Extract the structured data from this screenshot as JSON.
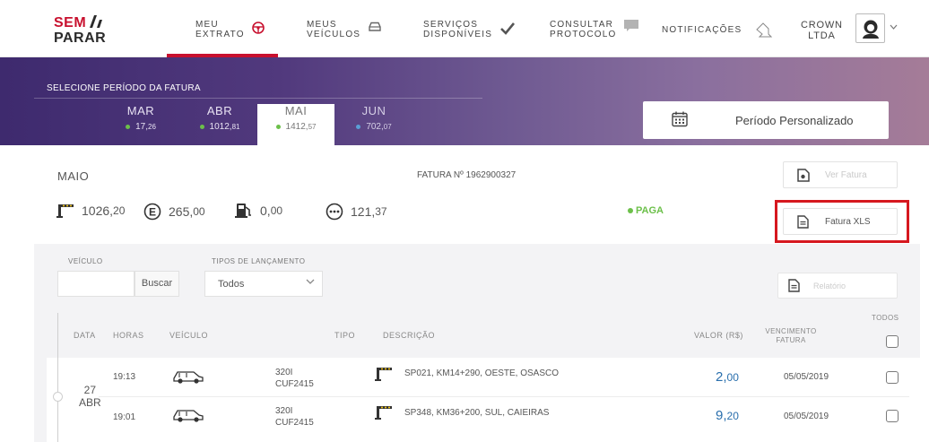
{
  "header": {
    "logo_line1": "SEM",
    "logo_line2": "PARAR",
    "nav": [
      {
        "line1": "MEU",
        "line2": "EXTRATO",
        "icon": "steering-wheel-icon",
        "active": true
      },
      {
        "line1": "MEUS",
        "line2": "VEÍCULOS",
        "icon": "car-icon",
        "active": false
      },
      {
        "line1": "SERVIÇOS",
        "line2": "DISPONÍVEIS",
        "icon": "check-icon",
        "active": false
      },
      {
        "line1": "CONSULTAR",
        "line2": "PROTOCOLO",
        "icon": "chat-bubble-icon",
        "active": false
      },
      {
        "line1": "NOTIFICAÇÕES",
        "line2": "",
        "icon": "bell-icon",
        "active": false
      }
    ],
    "company_line1": "CROWN",
    "company_line2": "LTDA",
    "accent_color": "#c8102e"
  },
  "period": {
    "title": "SELECIONE PERÍODO DA FATURA",
    "months": [
      {
        "name": "MAR",
        "value_int": "17",
        "value_dec": "26",
        "status": "paid"
      },
      {
        "name": "ABR",
        "value_int": "1012",
        "value_dec": "81",
        "status": "paid"
      },
      {
        "name": "MAI",
        "value_int": "1412",
        "value_dec": "57",
        "status": "selected"
      },
      {
        "name": "JUN",
        "value_int": "702",
        "value_dec": "07",
        "status": "open"
      }
    ],
    "custom_label": "Período Personalizado"
  },
  "summary": {
    "month": "MAIO",
    "fatura_label": "FATURA Nº 1962900327",
    "stats": [
      {
        "icon": "toll-icon",
        "int": "1026",
        "dec": "20"
      },
      {
        "icon": "parking-e-icon",
        "int": "265",
        "dec": "00"
      },
      {
        "icon": "fuel-icon",
        "int": "0",
        "dec": "00"
      },
      {
        "icon": "more-services-icon",
        "int": "121",
        "dec": "37"
      }
    ],
    "status": "PAGA",
    "ver_fatura": "Ver Fatura",
    "fatura_xls": "Fatura XLS"
  },
  "filters": {
    "veiculo_label": "VEÍCULO",
    "veiculo_value": "",
    "buscar": "Buscar",
    "tipos_label": "TIPOS DE LANÇAMENTO",
    "tipos_value": "Todos",
    "relatorio": "Relatório"
  },
  "table": {
    "headers": {
      "data": "DATA",
      "horas": "HORAS",
      "veiculo": "VEÍCULO",
      "tipo": "TIPO",
      "descricao": "DESCRIÇÃO",
      "valor": "VALOR (R$)",
      "vencimento_1": "VENCIMENTO",
      "vencimento_2": "FATURA",
      "todos": "TODOS"
    },
    "day": "27",
    "month": "ABR",
    "rows": [
      {
        "hora": "19:13",
        "modelo": "320I",
        "placa": "CUF2415",
        "descricao": "SP021, KM14+290, OESTE, OSASCO",
        "valor_int": "2",
        "valor_dec": "00",
        "vencimento": "05/05/2019"
      },
      {
        "hora": "19:01",
        "modelo": "320I",
        "placa": "CUF2415",
        "descricao": "SP348, KM36+200, SUL, CAIEIRAS",
        "valor_int": "9",
        "valor_dec": "20",
        "vencimento": "05/05/2019"
      }
    ]
  }
}
